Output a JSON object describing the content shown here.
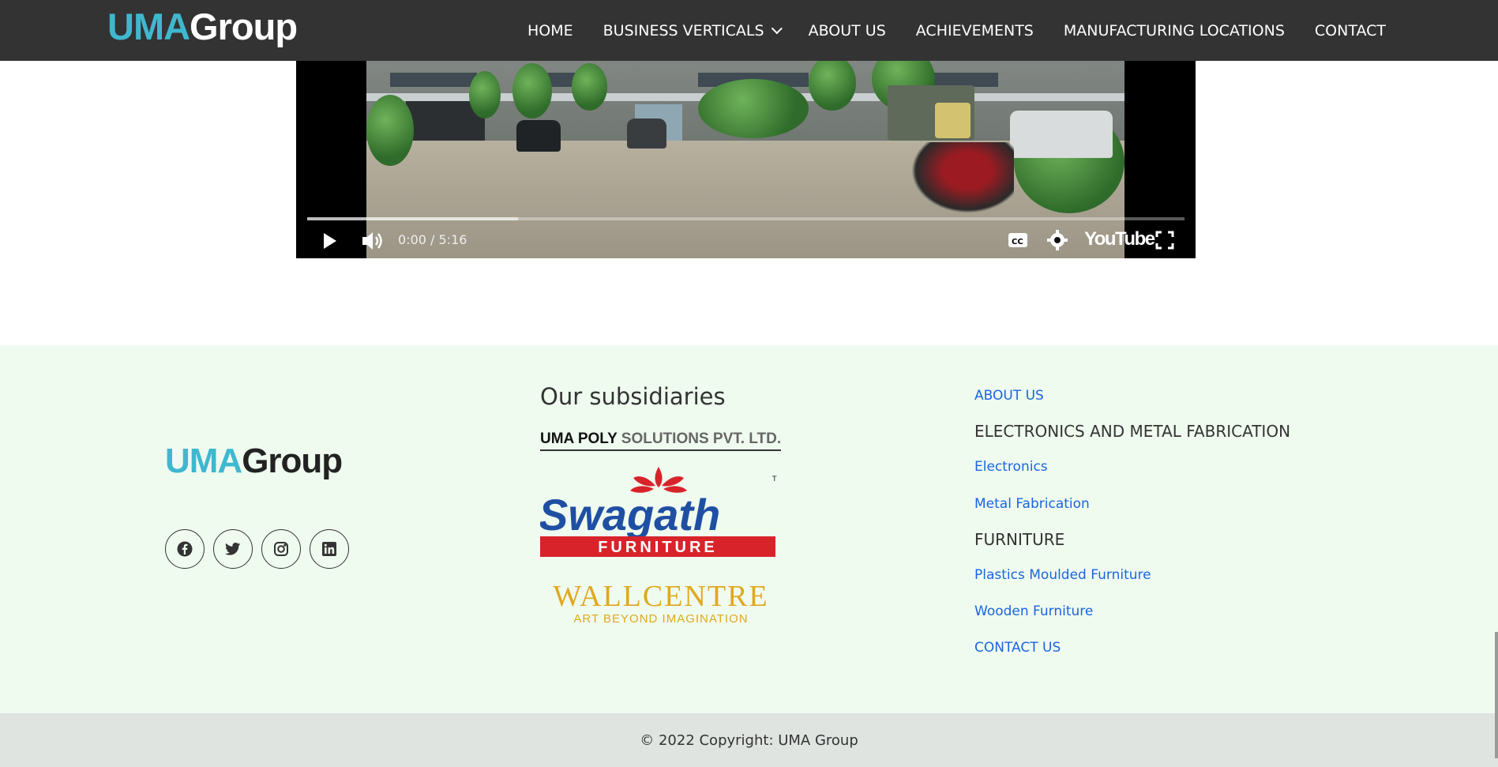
{
  "header": {
    "logo_part1": "UMA",
    "logo_part2": "Group",
    "nav": [
      {
        "label": "HOME"
      },
      {
        "label": "BUSINESS VERTICALS",
        "has_dropdown": true
      },
      {
        "label": "ABOUT US"
      },
      {
        "label": "ACHIEVEMENTS"
      },
      {
        "label": "MANUFACTURING LOCATIONS"
      },
      {
        "label": "CONTACT"
      }
    ]
  },
  "video": {
    "time": "0:00 / 5:16",
    "youtube_label": "YouTube",
    "icons": [
      "play-icon",
      "volume-icon",
      "captions-icon",
      "settings-icon",
      "youtube-logo",
      "fullscreen-icon"
    ]
  },
  "footer": {
    "logo_part1": "UMA",
    "logo_part2": "Group",
    "socials": [
      "facebook-icon",
      "twitter-icon",
      "instagram-icon",
      "linkedin-icon"
    ],
    "subsidiaries_title": "Our subsidiaries",
    "subsidiaries": {
      "poly_1": "UMA POLY",
      "poly_2": "SOLUTIONS  PVT. LTD.",
      "swagath": "Swagath",
      "swagath_sub": "FURNITURE",
      "swagath_tm": "TM",
      "wallcentre": "WALLCENTRE",
      "wallcentre_sub": "ART BEYOND IMAGINATION"
    },
    "links": {
      "about": "ABOUT US",
      "head_electronics": "ELECTRONICS AND METAL FABRICATION",
      "electronics": "Electronics",
      "metal": "Metal Fabrication",
      "head_furniture": "FURNITURE",
      "plastics": "Plastics Moulded Furniture",
      "wooden": "Wooden Furniture",
      "contact": "CONTACT US"
    },
    "copyright": "© 2022 Copyright: UMA Group"
  },
  "colors": {
    "accent": "#3fb8cf",
    "header_bg": "#333333",
    "footer_bg": "#effbef",
    "link": "#1a66e0",
    "copyright_bg": "#dfe4e1"
  }
}
